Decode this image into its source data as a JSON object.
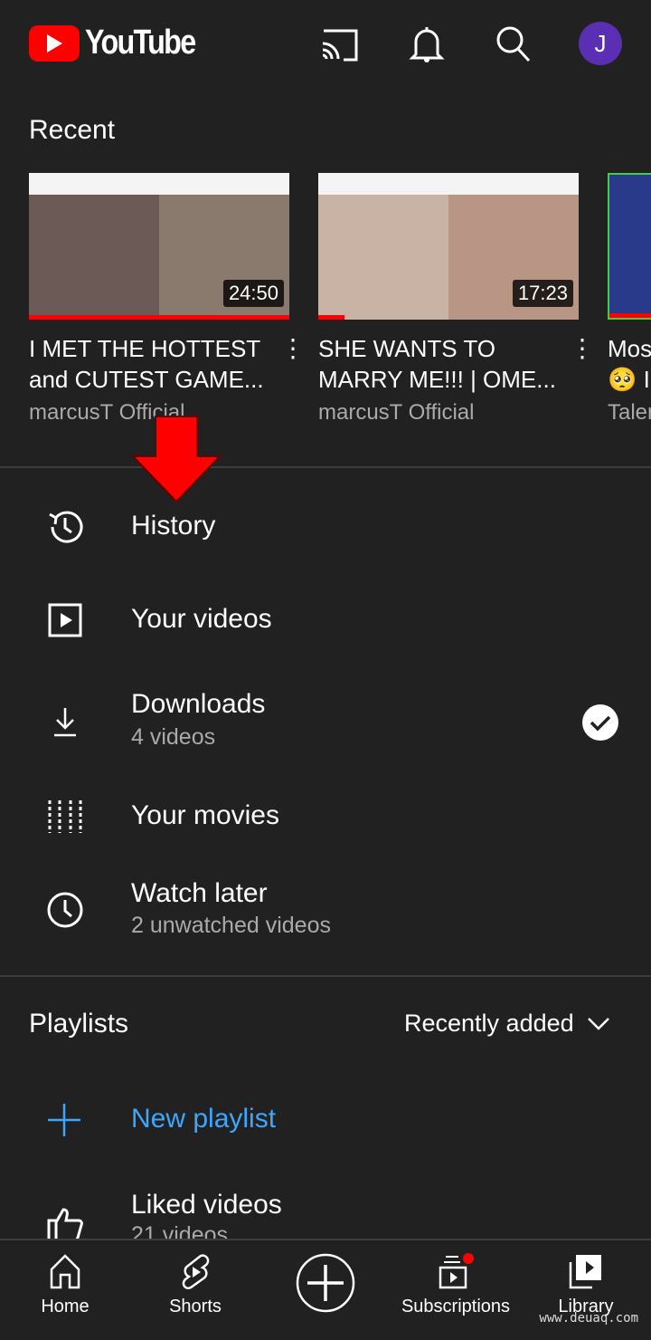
{
  "header": {
    "logo_text": "YouTube",
    "avatar_letter": "J",
    "avatar_color": "#5b2fb3",
    "icons": [
      "cast-icon",
      "bell-icon",
      "search-icon"
    ]
  },
  "recent": {
    "title": "Recent",
    "videos": [
      {
        "title_line1": "I MET THE HOTTEST",
        "title_line2": "and CUTEST GAME...",
        "channel": "marcusT Official",
        "duration": "24:50",
        "progress": 1.0
      },
      {
        "title_line1": "SHE WANTS TO",
        "title_line2": "MARRY ME!!! | OME...",
        "channel": "marcusT Official",
        "duration": "17:23",
        "progress": 0.1
      },
      {
        "title_line1": "Mos",
        "title_line2": "🥺 I",
        "channel": "Taler",
        "duration": "",
        "progress": 1.0
      }
    ]
  },
  "library": {
    "items": [
      {
        "label": "History",
        "icon": "history-icon"
      },
      {
        "label": "Your videos",
        "icon": "play-box-icon"
      },
      {
        "label": "Downloads",
        "sub": "4 videos",
        "icon": "download-icon",
        "status": "check-circle-icon"
      },
      {
        "label": "Your movies",
        "icon": "film-icon"
      },
      {
        "label": "Watch later",
        "sub": "2 unwatched videos",
        "icon": "clock-icon"
      }
    ]
  },
  "playlists": {
    "title": "Playlists",
    "sort": "Recently added",
    "new_playlist": "New playlist",
    "accent": "#3ea6ff",
    "liked": {
      "label": "Liked videos",
      "sub": "21 videos"
    }
  },
  "nav": {
    "items": [
      {
        "label": "Home"
      },
      {
        "label": "Shorts"
      },
      {
        "label": ""
      },
      {
        "label": "Subscriptions"
      },
      {
        "label": "Library"
      }
    ]
  },
  "watermark": "www.deuaq.com"
}
